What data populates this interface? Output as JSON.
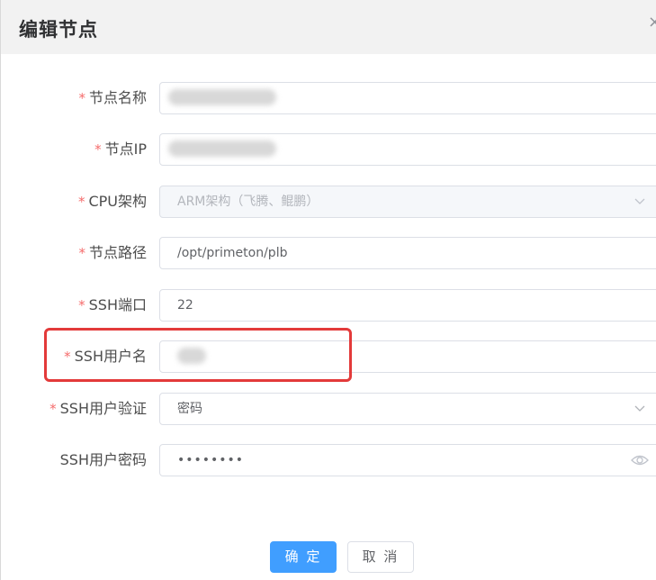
{
  "dialog": {
    "title": "编辑节点",
    "close_glyph": "×"
  },
  "fields": [
    {
      "label": "节点名称",
      "required": "*",
      "value": "",
      "masked": true
    },
    {
      "label": "节点IP",
      "required": "*",
      "value": "",
      "masked": true
    },
    {
      "label": "CPU架构",
      "required": "*",
      "value": "ARM架构（飞腾、鲲鹏）",
      "disabled": true,
      "type": "select"
    },
    {
      "label": "节点路径",
      "required": "*",
      "value": "/opt/primeton/plb"
    },
    {
      "label": "SSH端口",
      "required": "*",
      "value": "22"
    },
    {
      "label": "SSH用户名",
      "required": "*",
      "value": "",
      "masked": true,
      "highlighted": true
    },
    {
      "label": "SSH用户验证",
      "required": "*",
      "value": "密码",
      "type": "select"
    },
    {
      "label": "SSH用户密码",
      "required": "",
      "value": "••••••••",
      "type": "password"
    }
  ],
  "buttons": {
    "confirm": "确 定",
    "cancel": "取 消"
  },
  "colors": {
    "primary": "#409eff",
    "required": "#f56c6c",
    "highlight": "#e33a3a",
    "header_bg": "#f2f2f2"
  },
  "icons": {
    "close": "close-icon",
    "select": "chevron-down-icon",
    "password_toggle": "eye-icon"
  }
}
